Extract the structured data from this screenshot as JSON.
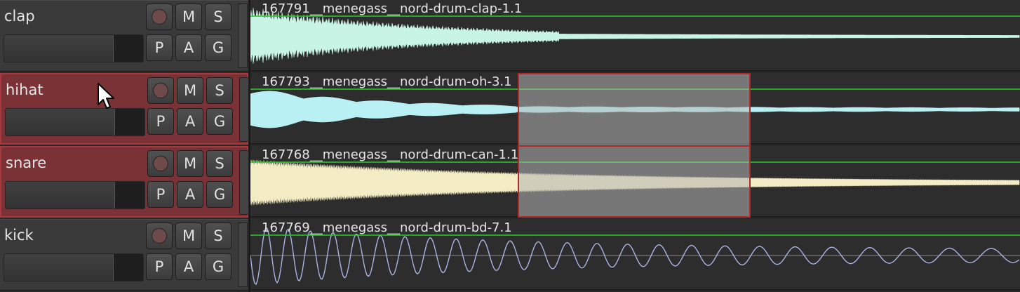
{
  "tracks": [
    {
      "id": "clap",
      "name": "clap",
      "selected": false,
      "clip": "167791__menegass__nord-drum-clap-1.1",
      "wave_color": "#c8f4e6",
      "wave": "noise_fast"
    },
    {
      "id": "hihat",
      "name": "hihat",
      "selected": true,
      "clip": "167793__menegass__nord-drum-oh-3.1",
      "wave_color": "#b8f0f4",
      "wave": "noise_long"
    },
    {
      "id": "snare",
      "name": "snare",
      "selected": true,
      "clip": "167768__menegass__nord-drum-can-1.1",
      "wave_color": "#f4ecc4",
      "wave": "buzz"
    },
    {
      "id": "kick",
      "name": "kick",
      "selected": false,
      "clip": "167769__menegass__nord-drum-bd-7.1",
      "wave_color": "#aab4e4",
      "wave": "sine"
    }
  ],
  "buttons": {
    "mute": "M",
    "solo": "S",
    "playlist": "P",
    "automation": "A",
    "group": "G"
  },
  "colors": {
    "gain_line": "#2ec82e",
    "selection_border": "#b02a2a",
    "selected_header": "#7a3236"
  }
}
